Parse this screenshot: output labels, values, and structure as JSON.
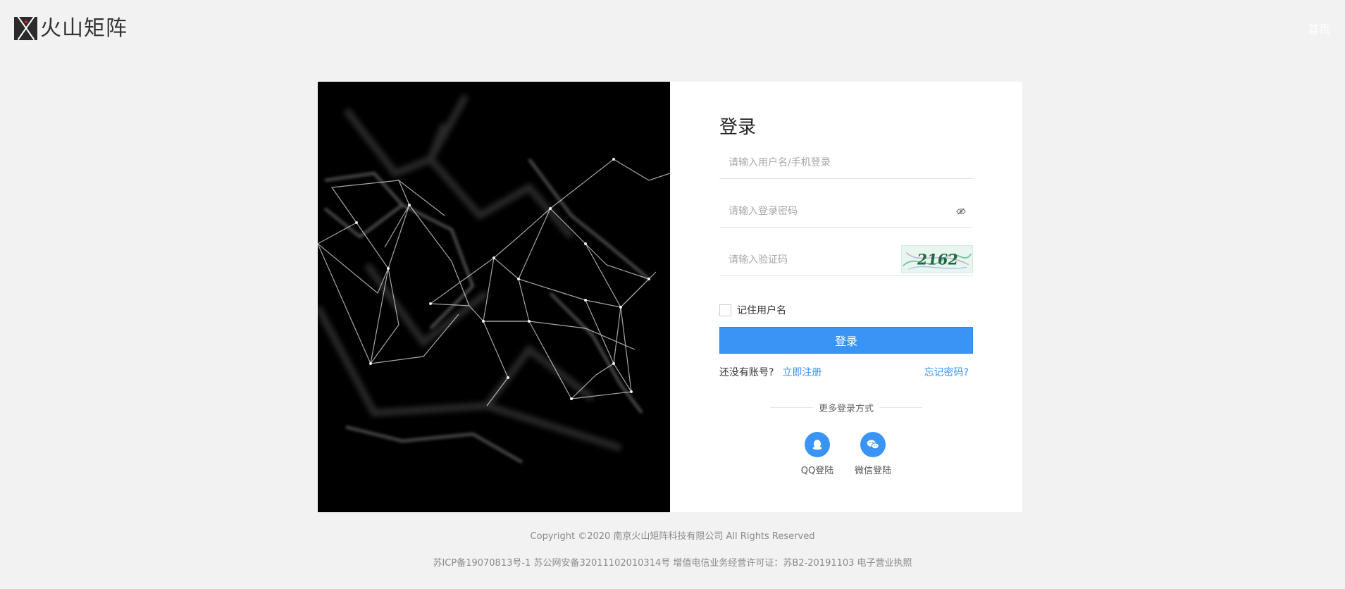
{
  "header": {
    "logo_text": "火山矩阵",
    "home_link": "首页"
  },
  "login": {
    "title": "登录",
    "username_placeholder": "请输入用户名/手机登录",
    "password_placeholder": "请输入登录密码",
    "captcha_placeholder": "请输入验证码",
    "captcha_text": "2162",
    "remember_label": "记住用户名",
    "login_button": "登录",
    "no_account_text": "还没有账号?",
    "register_link": "立即注册",
    "forgot_link": "忘记密码?",
    "more_methods": "更多登录方式",
    "qq_label": "QQ登陆",
    "wechat_label": "微信登陆"
  },
  "footer": {
    "copyright": "Copyright ©2020 南京火山矩阵科技有限公司 All Rights Reserved",
    "icp": "苏ICP备19070813号-1  苏公网安备32011102010314号  增值电信业务经营许可证：苏B2-20191103  电子营业执照"
  },
  "colors": {
    "accent": "#3a94f5",
    "page_bg": "#f2f2f2",
    "visual_bg": "#000000"
  }
}
